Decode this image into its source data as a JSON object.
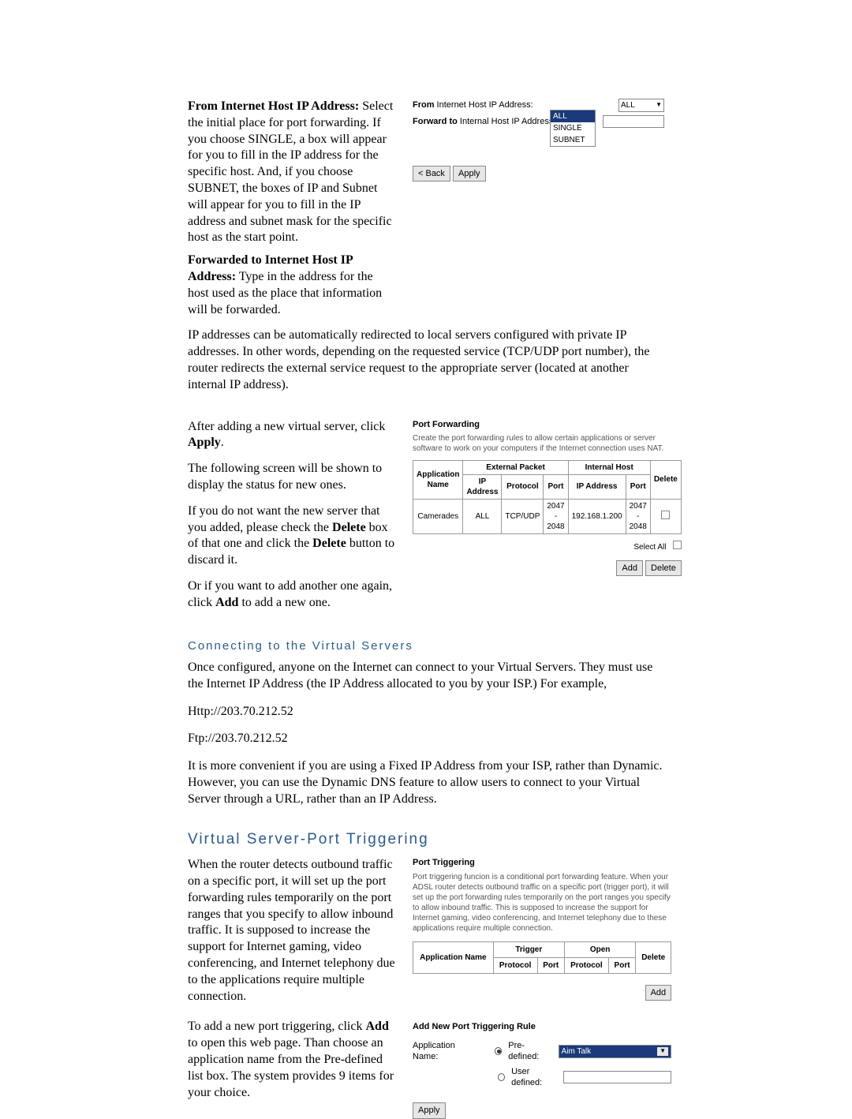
{
  "section1": {
    "heading1": "From Internet Host IP Address:",
    "para1": "Select the initial place for port forwarding. If you choose SINGLE, a box will appear for you to fill in the IP address for the specific host. And, if you choose SUBNET, the boxes of IP and Subnet will appear for you to fill in the IP address and subnet mask for the specific host as the start point.",
    "heading2": "Forwarded to Internet Host IP Address:",
    "para2": "Type in the address for the host used as the place that information will be forwarded."
  },
  "shot1": {
    "label1_prefix": "From",
    "label1_rest": " Internet Host IP Address:",
    "label2_prefix": "Forward to",
    "label2_rest": " Internal Host IP Address:",
    "sel_value": "ALL",
    "opts": {
      "a": "ALL",
      "b": "SINGLE",
      "c": "SUBNET"
    },
    "back": "< Back",
    "apply": "Apply"
  },
  "para_redirect": "IP addresses can be automatically redirected to local servers configured with private IP addresses. In other words, depending on the requested service (TCP/UDP port number), the router redirects the external service request to the appropriate server (located at another internal IP address).",
  "section_status": {
    "p1a": "After adding a new virtual server, click ",
    "p1b": "Apply",
    "p1c": ".",
    "p2": "The following screen will be shown to display the status for new ones.",
    "p3a": "If you do not want the new server that you added, please check the ",
    "p3b": "Delete",
    "p3c": " box of that one and click the ",
    "p3d": "Delete",
    "p3e": " button to discard it.",
    "p4a": "Or if you want to add another one again, click ",
    "p4b": "Add",
    "p4c": " to add a new one."
  },
  "pf": {
    "title": "Port Forwarding",
    "desc": "Create the port forwarding rules to allow certain applications or server software to work on your computers if the Internet connection uses NAT.",
    "h_app": "Application Name",
    "h_ext": "External Packet",
    "h_int": "Internal Host",
    "h_del": "Delete",
    "h_ip": "IP Address",
    "h_proto": "Protocol",
    "h_port": "Port",
    "row": {
      "app": "Camerades",
      "ext_ip": "ALL",
      "ext_proto": "TCP/UDP",
      "ext_port": "2047 - 2048",
      "int_ip": "192.168.1.200",
      "int_port": "2047 - 2048"
    },
    "selectall": "Select All",
    "add": "Add",
    "delete": "Delete"
  },
  "connect": {
    "heading": "Connecting to the Virtual Servers",
    "p1": "Once configured, anyone on the Internet can connect to your Virtual Servers. They must use the Internet IP Address (the IP Address allocated to you by your ISP.)   For example,",
    "url1": "Http://203.70.212.52",
    "url2": "Ftp://203.70.212.52",
    "p2": "It is more convenient if you are using a Fixed IP Address from your ISP, rather than Dynamic. However, you can use the Dynamic DNS feature to allow users to connect to your Virtual Server through a URL, rather than an IP Address."
  },
  "pt_heading": "Virtual Server-Port Triggering",
  "pt_left": {
    "p1": "When the router detects outbound traffic on a specific port, it will set up the port forwarding rules temporarily on the port ranges that you specify to allow inbound traffic. It is supposed to increase the support for Internet gaming, video conferencing, and Internet telephony due to the applications require multiple connection.",
    "p2a": "To add a new port triggering, click ",
    "p2b": "Add",
    "p2c": " to open this web page. Than choose an application name from the Pre-defined list box. The system provides 9 items for your choice."
  },
  "pt": {
    "title": "Port Triggering",
    "desc": "Port triggering funcion is a conditional port forwarding feature. When your ADSL router detects outbound traffic on a specific port (trigger port), it will set up the port forwarding rules temporarily on the port ranges you specify to allow inbound traffic. This is supposed to increase the support for Internet gaming, video conferencing, and Internet telephony due to these applications require multiple connection.",
    "h_app": "Application Name",
    "h_trigger": "Trigger",
    "h_open": "Open",
    "h_del": "Delete",
    "h_proto": "Protocol",
    "h_port": "Port",
    "add": "Add"
  },
  "rule": {
    "title": "Add New Port Triggering Rule",
    "label": "Application Name:",
    "predef": "Pre-defined:",
    "userdef": "User defined:",
    "predef_val": "Aim Talk",
    "apply": "Apply"
  }
}
